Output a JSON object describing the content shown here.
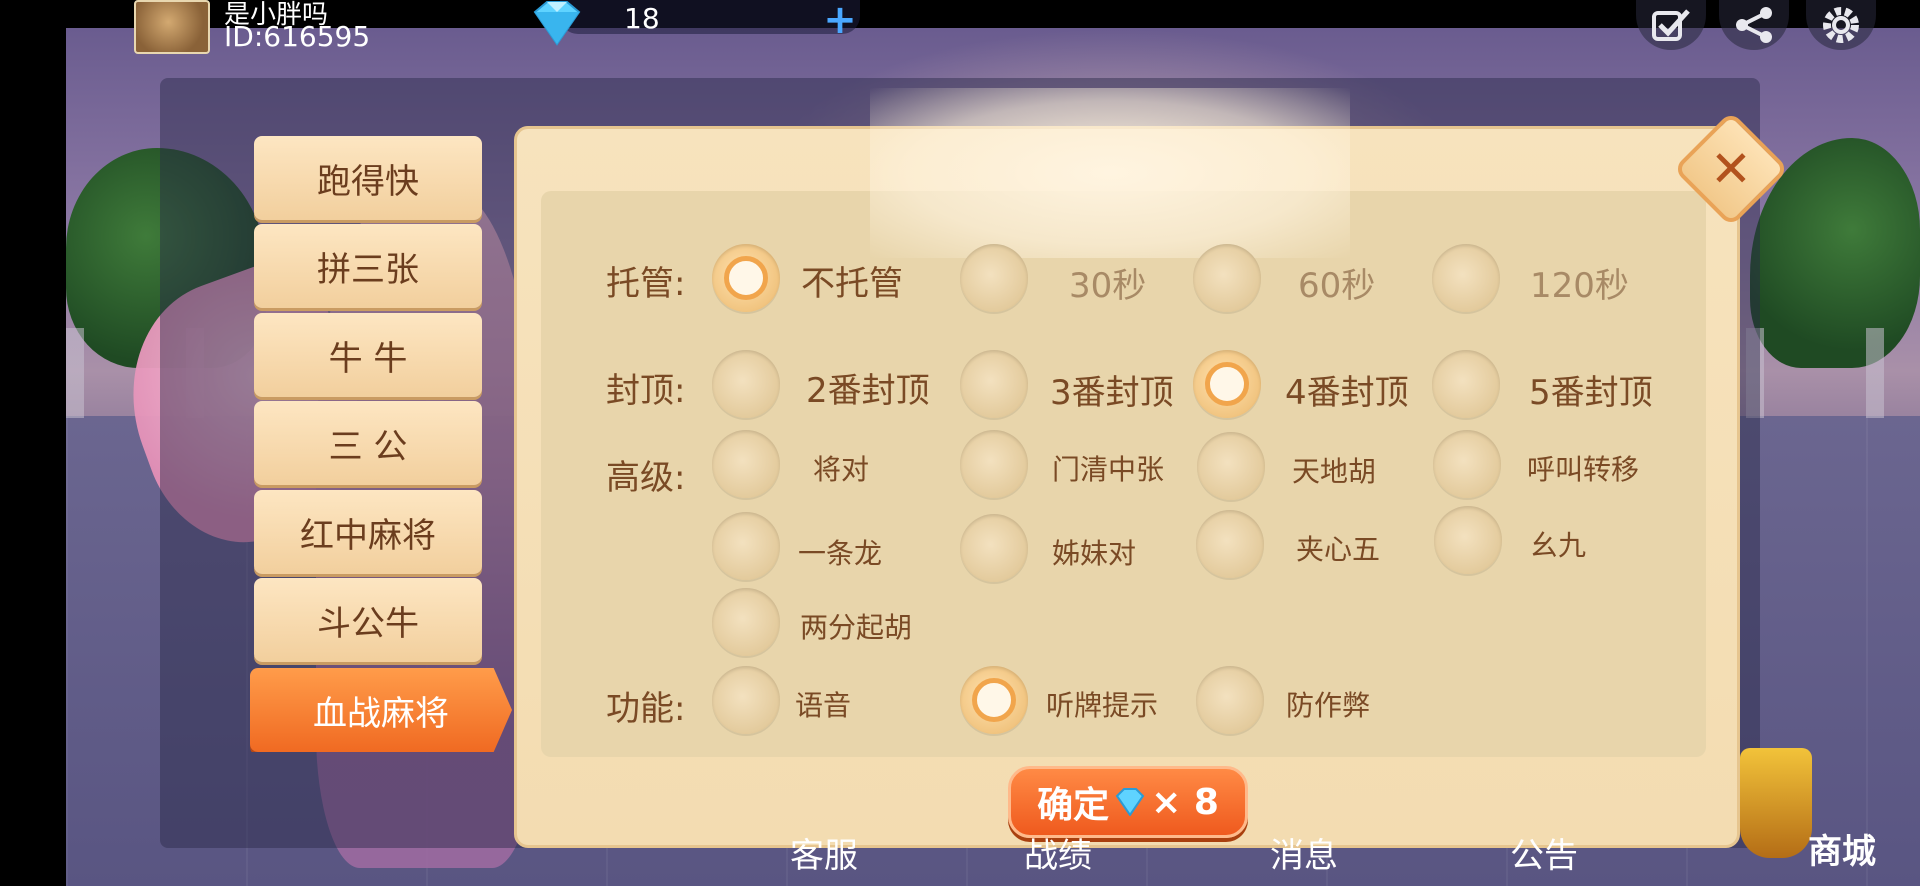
{
  "user": {
    "name": "是小胖吗",
    "id_text": "ID:616595",
    "diamonds": "18"
  },
  "side_menu": {
    "items": [
      {
        "label": "跑得快"
      },
      {
        "label": "拼三张"
      },
      {
        "label": "牛  牛"
      },
      {
        "label": "三  公"
      },
      {
        "label": "红中麻将"
      },
      {
        "label": "斗公牛"
      },
      {
        "label": "血战麻将"
      }
    ],
    "active_index": 6
  },
  "settings": {
    "hosting": {
      "label": "托管:",
      "options": [
        "不托管",
        "30秒",
        "60秒",
        "120秒"
      ],
      "selected": "不托管"
    },
    "cap": {
      "label": "封顶:",
      "options": [
        "2番封顶",
        "3番封顶",
        "4番封顶",
        "5番封顶"
      ],
      "selected": "4番封顶"
    },
    "advanced": {
      "label": "高级:",
      "options": [
        "将对",
        "门清中张",
        "天地胡",
        "呼叫转移",
        "一条龙",
        "姊妹对",
        "夹心五",
        "幺九",
        "两分起胡"
      ]
    },
    "features": {
      "label": "功能:",
      "options": [
        "语音",
        "听牌提示",
        "防作弊"
      ],
      "selected": "听牌提示"
    }
  },
  "confirm": {
    "label": "确定",
    "cost": "× 8"
  },
  "bottom_nav": {
    "items": [
      "客服",
      "战绩",
      "消息",
      "公告"
    ],
    "shop": "商城"
  },
  "icons": {
    "top_right": [
      "checklist-icon",
      "share-icon",
      "gear-icon"
    ],
    "close": "close-icon"
  },
  "colors": {
    "accent": "#f06a22",
    "panel": "#f3dcb1",
    "text": "#7a4a25"
  }
}
